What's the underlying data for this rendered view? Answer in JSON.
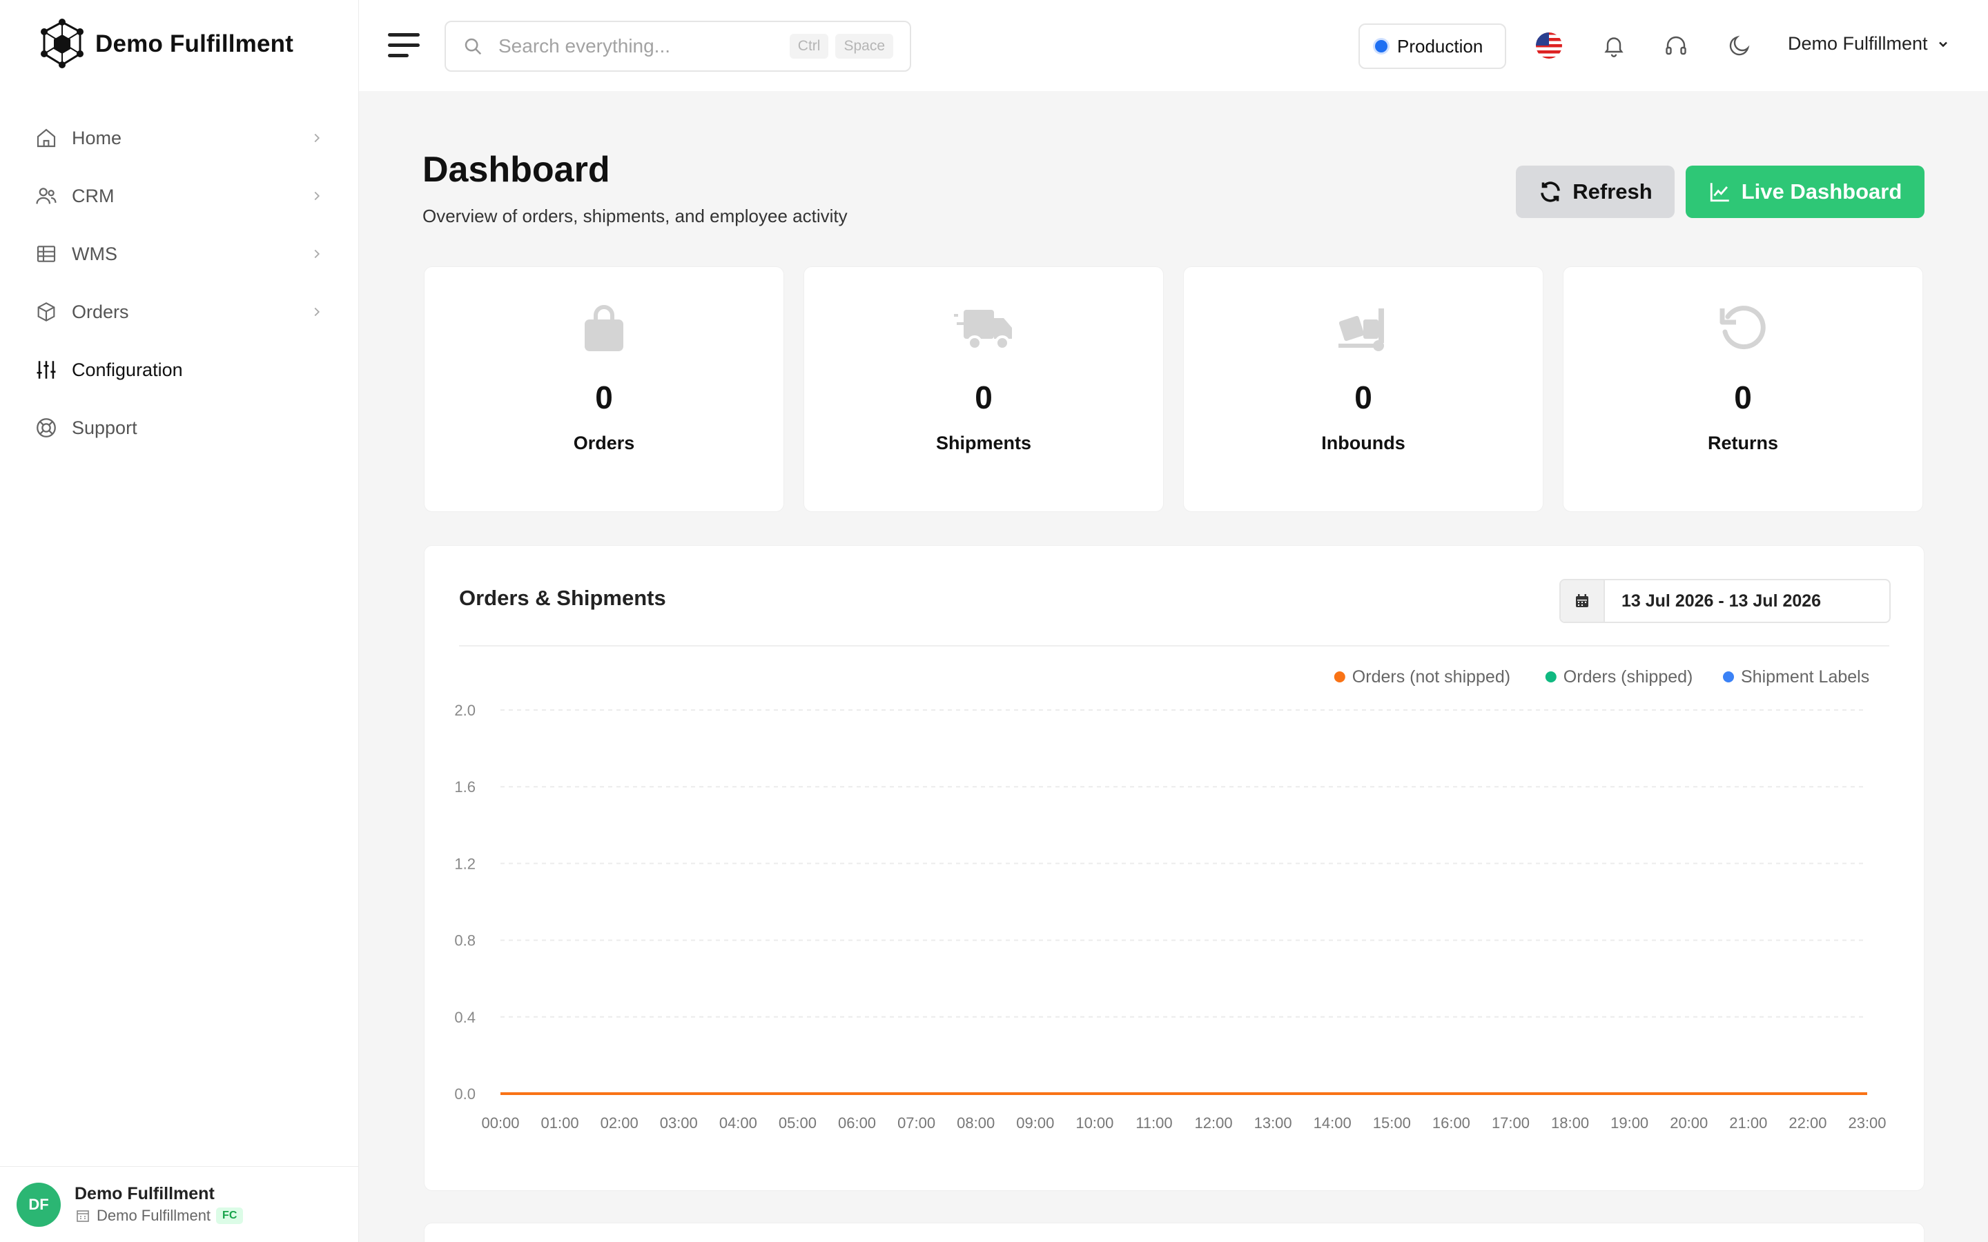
{
  "brand": {
    "name": "Demo Fulfillment"
  },
  "sidebar": {
    "items": [
      {
        "label": "Home",
        "icon": "home-icon",
        "has_submenu": true
      },
      {
        "label": "CRM",
        "icon": "users-icon",
        "has_submenu": true
      },
      {
        "label": "WMS",
        "icon": "grid-icon",
        "has_submenu": true
      },
      {
        "label": "Orders",
        "icon": "box-icon",
        "has_submenu": true
      },
      {
        "label": "Configuration",
        "icon": "sliders-icon",
        "has_submenu": false,
        "active": true
      },
      {
        "label": "Support",
        "icon": "lifebuoy-icon",
        "has_submenu": false
      }
    ],
    "footer": {
      "initials": "DF",
      "name": "Demo Fulfillment",
      "sub": "Demo Fulfillment",
      "badge": "FC"
    }
  },
  "topbar": {
    "search_placeholder": "Search everything...",
    "shortcut_keys": [
      "Ctrl",
      "Space"
    ],
    "environment": "Production",
    "user": "Demo Fulfillment"
  },
  "page": {
    "title": "Dashboard",
    "subtitle": "Overview of orders, shipments, and employee activity",
    "refresh_label": "Refresh",
    "live_label": "Live Dashboard"
  },
  "stats": [
    {
      "label": "Orders",
      "value": "0",
      "icon": "shopping-bag-icon"
    },
    {
      "label": "Shipments",
      "value": "0",
      "icon": "truck-icon"
    },
    {
      "label": "Inbounds",
      "value": "0",
      "icon": "dolly-icon"
    },
    {
      "label": "Returns",
      "value": "0",
      "icon": "undo-icon"
    }
  ],
  "colors": {
    "accent_green": "#2ec776",
    "env_blue": "#1e6ff2"
  },
  "chart_data": {
    "type": "line",
    "title": "Orders & Shipments",
    "date_range": "13 Jul 2026 - 13 Jul 2026",
    "x": [
      "00:00",
      "01:00",
      "02:00",
      "03:00",
      "04:00",
      "05:00",
      "06:00",
      "07:00",
      "08:00",
      "09:00",
      "10:00",
      "11:00",
      "12:00",
      "13:00",
      "14:00",
      "15:00",
      "16:00",
      "17:00",
      "18:00",
      "19:00",
      "20:00",
      "21:00",
      "22:00",
      "23:00"
    ],
    "y_ticks": [
      "0.0",
      "0.4",
      "0.8",
      "1.2",
      "1.6",
      "2.0"
    ],
    "ylim": [
      0,
      2
    ],
    "grid": true,
    "legend_position": "top-right",
    "series": [
      {
        "name": "Orders (not shipped)",
        "color": "#f97316",
        "values": [
          0,
          0,
          0,
          0,
          0,
          0,
          0,
          0,
          0,
          0,
          0,
          0,
          0,
          0,
          0,
          0,
          0,
          0,
          0,
          0,
          0,
          0,
          0,
          0
        ]
      },
      {
        "name": "Orders (shipped)",
        "color": "#10b981",
        "values": [
          0,
          0,
          0,
          0,
          0,
          0,
          0,
          0,
          0,
          0,
          0,
          0,
          0,
          0,
          0,
          0,
          0,
          0,
          0,
          0,
          0,
          0,
          0,
          0
        ]
      },
      {
        "name": "Shipment Labels",
        "color": "#3b82f6",
        "values": [
          0,
          0,
          0,
          0,
          0,
          0,
          0,
          0,
          0,
          0,
          0,
          0,
          0,
          0,
          0,
          0,
          0,
          0,
          0,
          0,
          0,
          0,
          0,
          0
        ]
      }
    ]
  }
}
